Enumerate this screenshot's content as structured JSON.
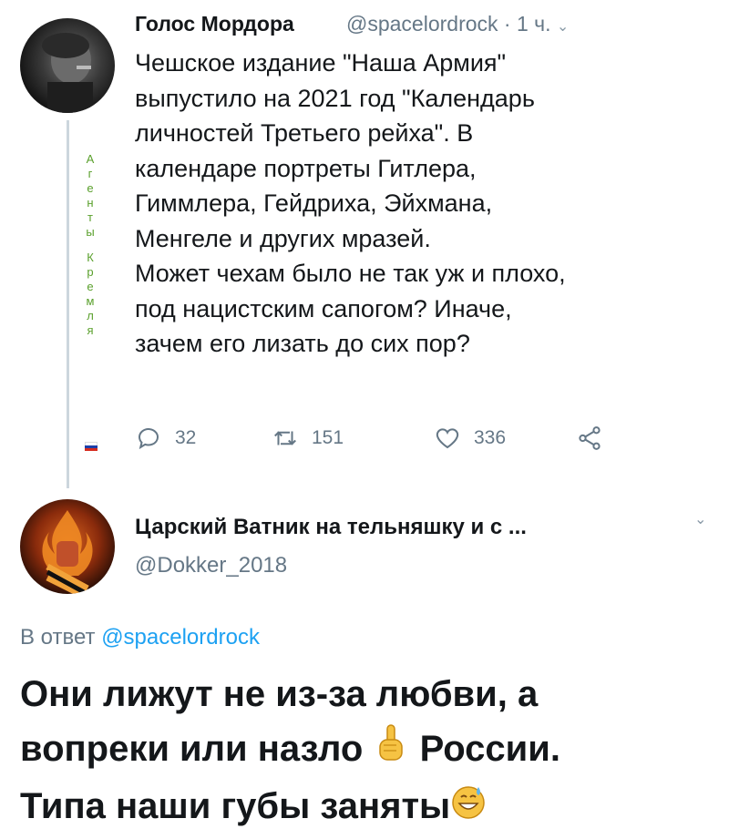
{
  "tweet": {
    "author_name": "Голос Мордора",
    "author_handle": "@spacelordrock",
    "time": "· 1 ч.",
    "vertical_label": [
      "А",
      "г",
      "е",
      "н",
      "т",
      "ы",
      "",
      "К",
      "р",
      "е",
      "м",
      "л",
      "я"
    ],
    "body": "Чешское издание \"Наша Армия\"\nвыпустило на 2021 год \"Календарь\nличностей Третьего рейха\". В\nкалендаре портреты Гитлера,\nГиммлера, Гейдриха, Эйхмана,\nМенгеле и других мразей.\nМожет чехам было не так уж и плохо,\nпод нацистским сапогом? Иначе,\nзачем его лизать до сих пор?",
    "reply_count": "32",
    "retweet_count": "151",
    "like_count": "336",
    "flag_colors": [
      "#ffffff",
      "#1c3fa8",
      "#d52b1e"
    ]
  },
  "reply": {
    "author_name": "Царский Ватник на тельняшку и с ...",
    "author_handle": "@Dokker_2018",
    "reply_prefix": "В ответ",
    "reply_to_handle": "@spacelordrock",
    "line1": "Они лижут не из-за любви, а",
    "line2_a": "вопреки или назло",
    "line2_b": "России.",
    "line3": "Типа наши губы заняты",
    "emoji_1": "pointing-up-hand-icon",
    "emoji_2": "grinning-sweat-emoji"
  },
  "colors": {
    "link": "#1da1f2",
    "muted": "#657786",
    "label_green": "#5aa02c"
  }
}
